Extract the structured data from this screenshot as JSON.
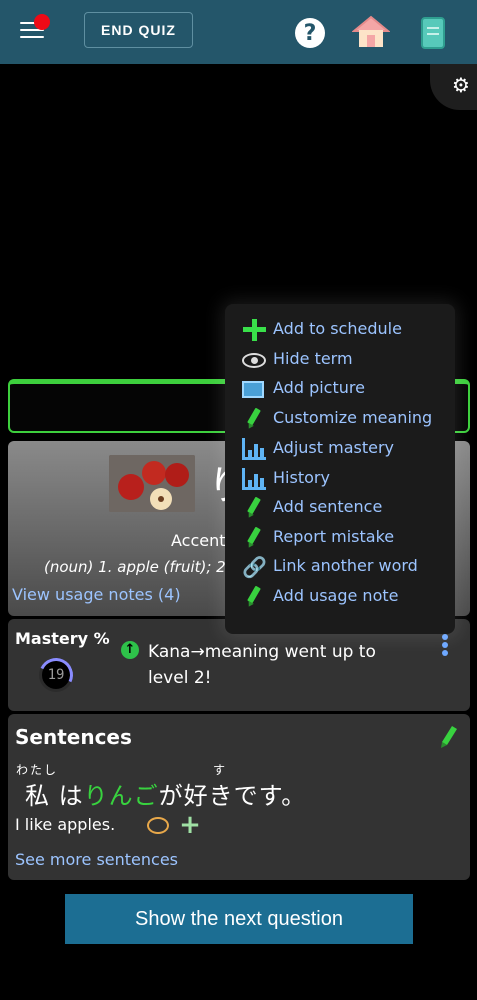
{
  "header": {
    "end_quiz_label": "END QUIZ",
    "help_glyph": "?"
  },
  "word": {
    "kana_partial": "り",
    "accent_label": "Accent:",
    "meaning_text": "(noun) 1. apple (fruit); 2",
    "usage_link": "View usage notes (4)"
  },
  "mastery": {
    "title": "Mastery %",
    "value": "19",
    "message": "Kana→meaning went up to level 2!"
  },
  "sentences": {
    "title": "Sentences",
    "furigana_watashi": "わたし",
    "furigana_su": "す",
    "jp_part1": "私 は",
    "jp_highlight": "りんご",
    "jp_part2": "が好きです。",
    "english": "I like apples.",
    "see_more": "See more sentences"
  },
  "next_button": "Show the next question",
  "menu": {
    "items": [
      {
        "label": "Add to schedule",
        "icon": "plus-icon"
      },
      {
        "label": "Hide term",
        "icon": "eye-icon"
      },
      {
        "label": "Add picture",
        "icon": "picture-icon"
      },
      {
        "label": "Customize meaning",
        "icon": "pencil-icon"
      },
      {
        "label": "Adjust mastery",
        "icon": "bar-chart-icon"
      },
      {
        "label": "History",
        "icon": "bar-chart-icon"
      },
      {
        "label": "Add sentence",
        "icon": "pencil-icon"
      },
      {
        "label": "Report mistake",
        "icon": "pencil-icon"
      },
      {
        "label": "Link another word",
        "icon": "link-icon"
      },
      {
        "label": "Add usage note",
        "icon": "pencil-icon"
      }
    ]
  },
  "colors": {
    "header_bg": "#24566a",
    "accent_green": "#38d23f",
    "link_blue": "#9cc4ff",
    "button_blue": "#1c6e93",
    "notification_red": "#ee0a16"
  }
}
